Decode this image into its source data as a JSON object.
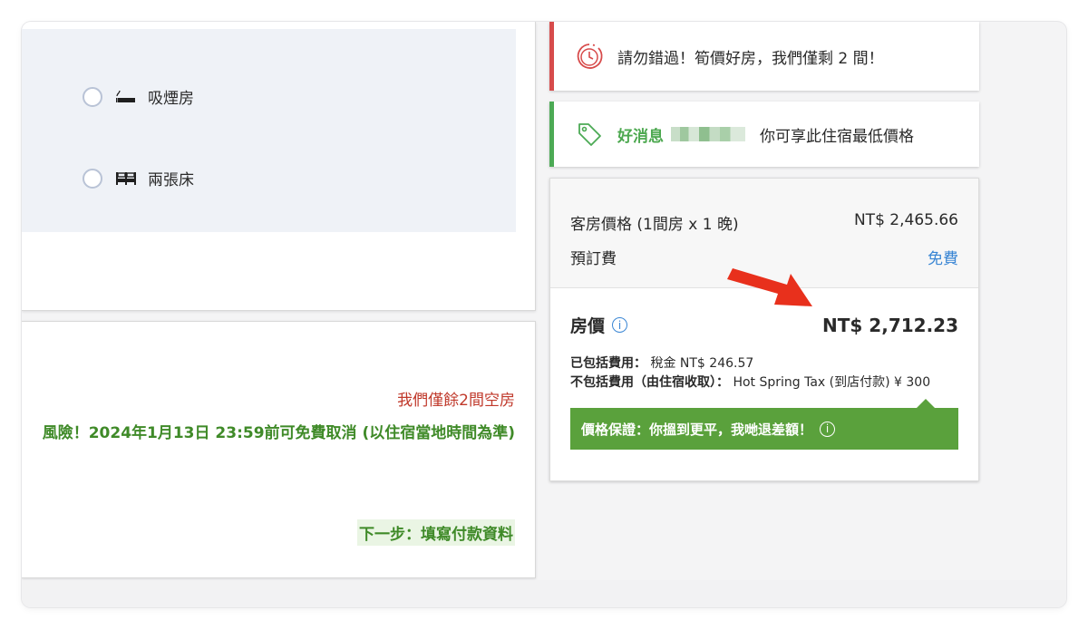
{
  "room_options": [
    {
      "label": "吸煙房",
      "icon": "smoking-icon"
    },
    {
      "label": "兩張床",
      "icon": "twin-beds-icon"
    }
  ],
  "booking": {
    "scarcity": "我們僅餘2間空房",
    "free_cancel": "風險！2024年1月13日 23:59前可免費取消 (以住宿當地時間為準)",
    "next_step": "下一步：填寫付款資料"
  },
  "alerts": {
    "urgency": "請勿錯過！筍價好房，我們僅剩 2 間！",
    "good_news_label": "好消息",
    "good_news_text": "你可享此住宿最低價格"
  },
  "pricing": {
    "room_price_label": "客房價格 (1間房 x 1 晚)",
    "room_price_value": "NT$ 2,465.66",
    "booking_fee_label": "預訂費",
    "booking_fee_value": "免費",
    "total_label": "房價",
    "total_value": "NT$ 2,712.23",
    "included_label": "已包括費用：",
    "included_value": "稅金 NT$ 246.57",
    "excluded_label": "不包括費用（由住宿收取）：",
    "excluded_value": "Hot Spring Tax (到店付款) ¥ 300",
    "guarantee": "價格保證：你搵到更平，我哋退差額！"
  },
  "colors": {
    "danger": "#d74b4b",
    "success": "#4caa55",
    "guarantee_bg": "#5aa13c",
    "link_blue": "#3a86d4",
    "arrow_red": "#e8301c"
  }
}
